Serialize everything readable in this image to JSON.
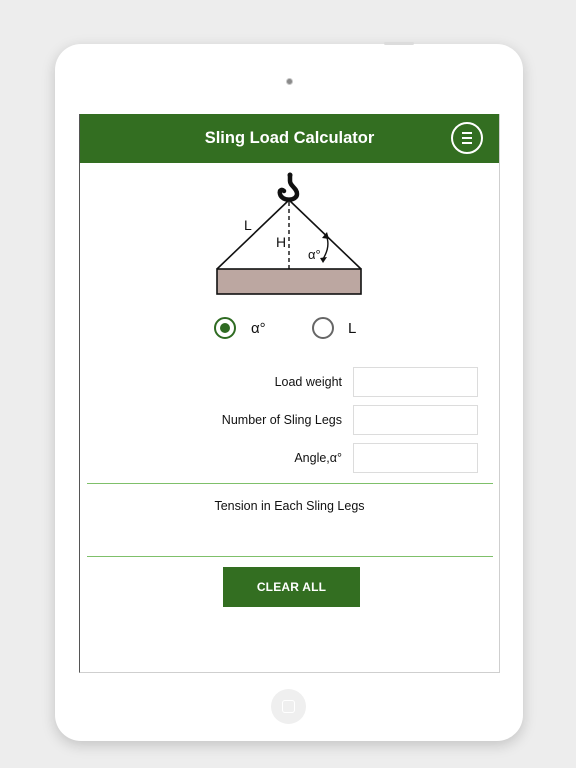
{
  "app": {
    "title": "Sling Load Calculator"
  },
  "diagram": {
    "leg_label": "L",
    "height_label": "H",
    "angle_label": "α°"
  },
  "mode": {
    "selected": "angle",
    "options": [
      {
        "label": "α°",
        "selected": true
      },
      {
        "label": "L",
        "selected": false
      }
    ]
  },
  "form": {
    "fields": [
      {
        "label": "Load weight",
        "value": ""
      },
      {
        "label": "Number of Sling Legs",
        "value": ""
      },
      {
        "label": "Angle,α°",
        "value": ""
      }
    ]
  },
  "result": {
    "label": "Tension in Each Sling Legs",
    "value": ""
  },
  "actions": {
    "clear_label": "CLEAR ALL"
  },
  "colors": {
    "primary_green": "#336e21",
    "divider_green": "#7fc06a",
    "load_block": "#bca7a1"
  },
  "icons": {
    "menu": "hamburger-circle-icon",
    "hook": "crane-hook-icon",
    "home": "home-button-icon"
  }
}
